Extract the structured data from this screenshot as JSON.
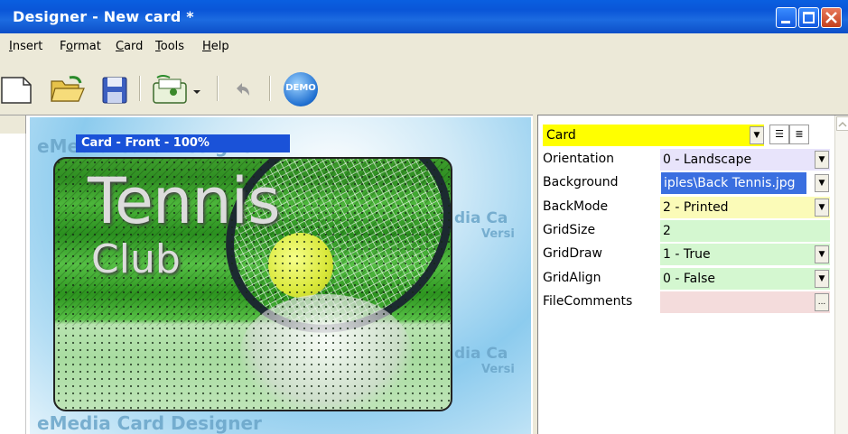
{
  "window": {
    "title": "Designer - New card *"
  },
  "menu": [
    "Insert",
    "Format",
    "Card",
    "Tools",
    "Help"
  ],
  "menu_underline": [
    "I",
    "o",
    "C",
    "T",
    "H"
  ],
  "toolbar": {
    "demo_label": "DEMO"
  },
  "canvas": {
    "label": "Card - Front - 100%",
    "watermark_top": "eMedia Card Designer",
    "watermark_bottom": "eMedia Card Designer",
    "watermark_mid1": "dia Ca",
    "watermark_mid1b": "Versi",
    "watermark_mid2": "dia Ca",
    "watermark_mid2b": "Versi",
    "card_title": "Tennis",
    "card_subtitle": "Club"
  },
  "properties": {
    "object": "Card",
    "rows": [
      {
        "name": "Orientation",
        "value": "0 - Landscape",
        "color": "#e8e4fb",
        "control": "dropdown"
      },
      {
        "name": "Background",
        "value": "iples\\Back Tennis.jpg",
        "color": "#e8e4fb",
        "control": "dropdown",
        "selected": true
      },
      {
        "name": "BackMode",
        "value": "2 - Printed",
        "color": "#fbfbb8",
        "control": "dropdown"
      },
      {
        "name": "GridSize",
        "value": "2",
        "color": "#d4f7d0",
        "control": "none"
      },
      {
        "name": "GridDraw",
        "value": "1 - True",
        "color": "#d4f7d0",
        "control": "dropdown"
      },
      {
        "name": "GridAlign",
        "value": "0 - False",
        "color": "#d4f7d0",
        "control": "dropdown"
      },
      {
        "name": "FileComments",
        "value": "",
        "color": "#f4dcdc",
        "control": "ellipsis"
      }
    ]
  }
}
